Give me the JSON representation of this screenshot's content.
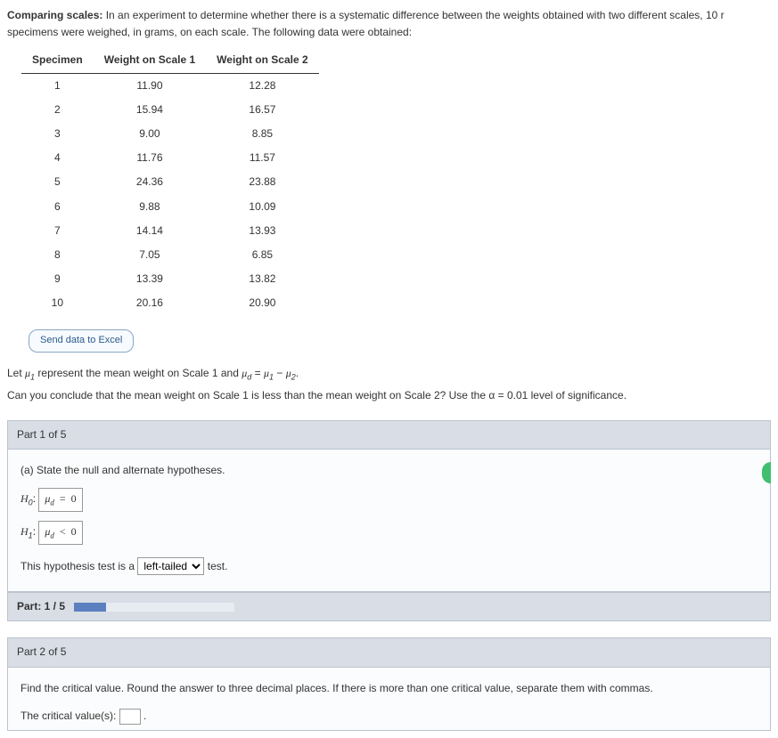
{
  "intro": {
    "title": "Comparing scales:",
    "text": " In an experiment to determine whether there is a systematic difference between the weights obtained with two different scales, 10 r",
    "text2": "specimens were weighed, in grams, on each scale. The following data were obtained:"
  },
  "table": {
    "headers": [
      "Specimen",
      "Weight on Scale 1",
      "Weight on Scale 2"
    ],
    "rows": [
      [
        "1",
        "11.90",
        "12.28"
      ],
      [
        "2",
        "15.94",
        "16.57"
      ],
      [
        "3",
        "9.00",
        "8.85"
      ],
      [
        "4",
        "11.76",
        "11.57"
      ],
      [
        "5",
        "24.36",
        "23.88"
      ],
      [
        "6",
        "9.88",
        "10.09"
      ],
      [
        "7",
        "14.14",
        "13.93"
      ],
      [
        "8",
        "7.05",
        "6.85"
      ],
      [
        "9",
        "13.39",
        "13.82"
      ],
      [
        "10",
        "20.16",
        "20.90"
      ]
    ]
  },
  "excel_btn": "Send data to Excel",
  "let_line": {
    "pre": "Let ",
    "mu1": "μ",
    "sub1": "1",
    "mid": " represent the mean weight on Scale 1 and ",
    "mud": "μ",
    "subd": "d",
    "eq": " = ",
    "mu1b": "μ",
    "sub1b": "1",
    "minus": " − ",
    "mu2": "μ",
    "sub2": "2",
    "dot": "."
  },
  "question": "Can you conclude that the mean weight on Scale 1 is less than the mean weight on Scale 2? Use the α = 0.01 level of significance.",
  "part1": {
    "header": "Part 1 of 5",
    "prompt": "(a) State the null and alternate hypotheses.",
    "h0_label": "H",
    "h0_sub": "0",
    "h0_colon": ": ",
    "h0_ans": "μd  =  0",
    "h1_label": "H",
    "h1_sub": "1",
    "h1_colon": ": ",
    "h1_ans": "μd  <  0",
    "tail_pre": "This hypothesis test is a ",
    "tail_sel": "left-tailed",
    "tail_post": " test."
  },
  "progress": {
    "label": "Part: 1 / 5"
  },
  "part2": {
    "header": "Part 2 of 5",
    "prompt": "Find the critical value. Round the answer to three decimal places. If there is more than one critical value, separate them with commas.",
    "ans_label": "The critical value(s): "
  },
  "chart_data": {
    "type": "table",
    "headers": [
      "Specimen",
      "Weight on Scale 1",
      "Weight on Scale 2"
    ],
    "rows": [
      [
        1,
        11.9,
        12.28
      ],
      [
        2,
        15.94,
        16.57
      ],
      [
        3,
        9.0,
        8.85
      ],
      [
        4,
        11.76,
        11.57
      ],
      [
        5,
        24.36,
        23.88
      ],
      [
        6,
        9.88,
        10.09
      ],
      [
        7,
        14.14,
        13.93
      ],
      [
        8,
        7.05,
        6.85
      ],
      [
        9,
        13.39,
        13.82
      ],
      [
        10,
        20.16,
        20.9
      ]
    ]
  }
}
